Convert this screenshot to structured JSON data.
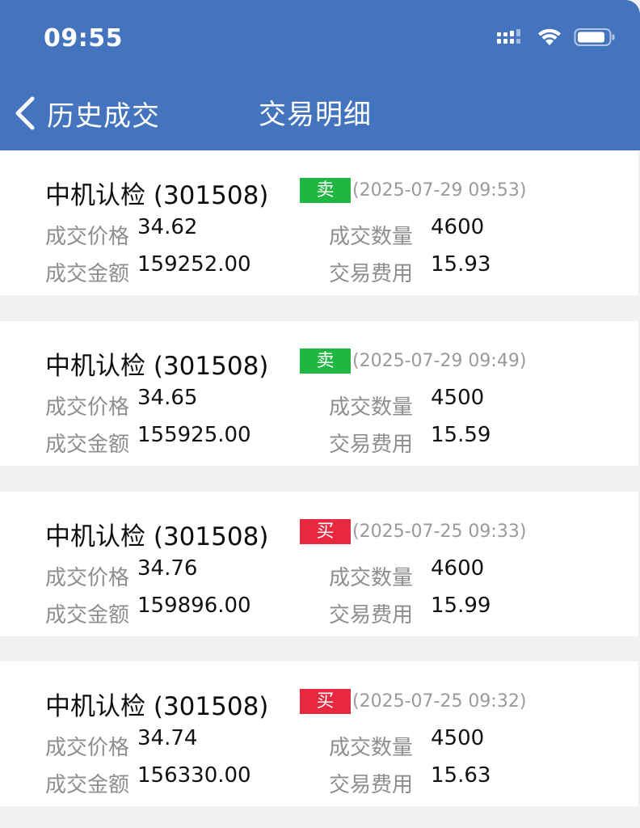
{
  "status_bar": {
    "time": "09:55"
  },
  "nav": {
    "back_label": "历史成交",
    "title": "交易明细"
  },
  "labels": {
    "price": "成交价格",
    "quantity": "成交数量",
    "amount": "成交金额",
    "fee": "交易费用"
  },
  "trades": [
    {
      "name": "中机认检 (301508)",
      "side": "卖",
      "time": "(2025-07-29 09:53)",
      "price": "34.62",
      "quantity": "4600",
      "amount": "159252.00",
      "fee": "15.93"
    },
    {
      "name": "中机认检 (301508)",
      "side": "卖",
      "time": "(2025-07-29 09:49)",
      "price": "34.65",
      "quantity": "4500",
      "amount": "155925.00",
      "fee": "15.59"
    },
    {
      "name": "中机认检 (301508)",
      "side": "买",
      "time": "(2025-07-25 09:33)",
      "price": "34.76",
      "quantity": "4600",
      "amount": "159896.00",
      "fee": "15.99"
    },
    {
      "name": "中机认检 (301508)",
      "side": "买",
      "time": "(2025-07-25 09:32)",
      "price": "34.74",
      "quantity": "4500",
      "amount": "156330.00",
      "fee": "15.63"
    }
  ],
  "colors": {
    "header_bg": "#4374bd",
    "sell_badge": "#1fb641",
    "buy_badge": "#e8283e",
    "page_bg": "#f1f1f3"
  }
}
